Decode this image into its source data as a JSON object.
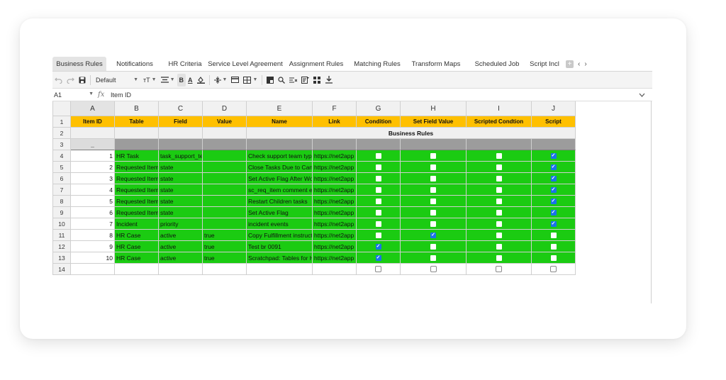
{
  "tabs": [
    {
      "label": "Business Rules",
      "active": true
    },
    {
      "label": "Notifications",
      "active": false
    },
    {
      "label": "HR Criteria",
      "active": false
    },
    {
      "label": "Service Level Agreement",
      "active": false
    },
    {
      "label": "Assignment Rules",
      "active": false
    },
    {
      "label": "Matching Rules",
      "active": false
    },
    {
      "label": "Transform Maps",
      "active": false
    },
    {
      "label": "Scheduled Job",
      "active": false
    },
    {
      "label": "Script Incl",
      "active": false
    }
  ],
  "toolbar": {
    "font": "Default",
    "icons": [
      "undo-icon",
      "redo-icon",
      "save-icon",
      "font-size-icon",
      "align-icon",
      "bold-icon",
      "font-color-icon",
      "fill-color-icon",
      "valign-icon",
      "merge-icon",
      "borders-icon",
      "freeze-icon",
      "search-icon",
      "clear-format-icon",
      "filter-icon",
      "chart-icon",
      "download-icon"
    ],
    "bold_label": "B",
    "font_color_label": "A",
    "font_size_label": "ᴛT"
  },
  "formula_bar": {
    "cell_ref": "A1",
    "fx": "fx",
    "value": "Item ID"
  },
  "grid": {
    "columns": [
      "A",
      "B",
      "C",
      "D",
      "E",
      "F",
      "G",
      "H",
      "I",
      "J"
    ],
    "headers": [
      "Item ID",
      "Table",
      "Field",
      "Value",
      "Name",
      "Link",
      "Condition",
      "Set Field Value",
      "Scripted Condtion",
      "Script"
    ],
    "row_numbers": [
      "1",
      "2",
      "3",
      "4",
      "5",
      "6",
      "7",
      "8",
      "9",
      "10",
      "11",
      "12",
      "13",
      "14"
    ],
    "merged_label": "Business Rules",
    "row3_marker": "_",
    "rows": [
      {
        "id": "1",
        "table": "HR Task",
        "field": "task_support_team",
        "value": "",
        "name": "Check support team type",
        "link": "https://net2app",
        "condition": false,
        "set_field": false,
        "scripted": false,
        "script": true
      },
      {
        "id": "2",
        "table": "Requested Item",
        "field": "state",
        "value": "",
        "name": "Close Tasks Due to Cancel",
        "link": "https://net2app",
        "condition": false,
        "set_field": false,
        "scripted": false,
        "script": true
      },
      {
        "id": "3",
        "table": "Requested Item",
        "field": "state",
        "value": "",
        "name": "Set Active Flag After Workflow",
        "link": "https://net2app",
        "condition": false,
        "set_field": false,
        "scripted": false,
        "script": true
      },
      {
        "id": "4",
        "table": "Requested Item",
        "field": "state",
        "value": "",
        "name": "sc_req_item comment events",
        "link": "https://net2app",
        "condition": false,
        "set_field": false,
        "scripted": false,
        "script": true
      },
      {
        "id": "5",
        "table": "Requested Item",
        "field": "state",
        "value": "",
        "name": "Restart Children tasks",
        "link": "https://net2app",
        "condition": false,
        "set_field": false,
        "scripted": false,
        "script": true
      },
      {
        "id": "6",
        "table": "Requested Item",
        "field": "state",
        "value": "",
        "name": "Set Active Flag",
        "link": "https://net2app",
        "condition": false,
        "set_field": false,
        "scripted": false,
        "script": true
      },
      {
        "id": "7",
        "table": "Incident",
        "field": "priority",
        "value": "",
        "name": "incident events",
        "link": "https://net2app",
        "condition": false,
        "set_field": false,
        "scripted": false,
        "script": true
      },
      {
        "id": "8",
        "table": "HR Case",
        "field": "active",
        "value": "true",
        "name": "Copy Fulfillment instructions",
        "link": "https://net2app",
        "condition": false,
        "set_field": true,
        "scripted": false,
        "script": false
      },
      {
        "id": "9",
        "table": "HR Case",
        "field": "active",
        "value": "true",
        "name": "Test br 0091",
        "link": "https://net2app",
        "condition": true,
        "set_field": false,
        "scripted": false,
        "script": false
      },
      {
        "id": "10",
        "table": "HR Case",
        "field": "active",
        "value": "true",
        "name": "Scratchpad: Tables for HR",
        "link": "https://net2app",
        "condition": true,
        "set_field": false,
        "scripted": false,
        "script": false
      }
    ]
  },
  "colors": {
    "header_fill": "#ffc000",
    "row_fill": "#1bcb12",
    "checkbox_on": "#1a73e8"
  }
}
